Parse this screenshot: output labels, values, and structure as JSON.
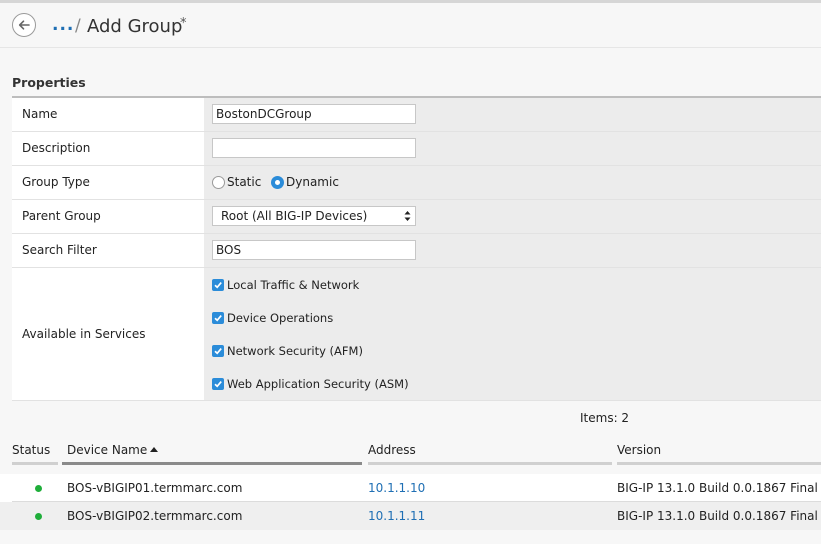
{
  "header": {
    "breadcrumb_ellipsis": "...",
    "separator": "/",
    "title": "Add Group",
    "unsaved_marker": "*"
  },
  "properties": {
    "section_title": "Properties",
    "fields": {
      "name": {
        "label": "Name",
        "value": "BostonDCGroup"
      },
      "description": {
        "label": "Description",
        "value": ""
      },
      "group_type": {
        "label": "Group Type",
        "options": [
          {
            "label": "Static",
            "selected": false
          },
          {
            "label": "Dynamic",
            "selected": true
          }
        ]
      },
      "parent_group": {
        "label": "Parent Group",
        "value": "Root (All BIG-IP Devices)"
      },
      "search_filter": {
        "label": "Search Filter",
        "value": "BOS"
      },
      "available_in_services": {
        "label": "Available in Services",
        "options": [
          {
            "label": "Local Traffic & Network",
            "checked": true
          },
          {
            "label": "Device Operations",
            "checked": true
          },
          {
            "label": "Network Security (AFM)",
            "checked": true
          },
          {
            "label": "Web Application Security (ASM)",
            "checked": true
          }
        ]
      }
    }
  },
  "devices": {
    "items_count": "Items: 2",
    "columns": {
      "status": "Status",
      "device_name": "Device Name",
      "address": "Address",
      "version": "Version"
    },
    "sorted_column": "device_name",
    "sort_direction": "ascending",
    "rows": [
      {
        "status": "online",
        "device_name": "BOS-vBIGIP01.termmarc.com",
        "address": "10.1.1.10",
        "version": "BIG-IP 13.1.0 Build 0.0.1867 Final"
      },
      {
        "status": "online",
        "device_name": "BOS-vBIGIP02.termmarc.com",
        "address": "10.1.1.11",
        "version": "BIG-IP 13.1.0 Build 0.0.1867 Final"
      }
    ]
  },
  "colors": {
    "accent": "#2b8cd9",
    "link": "#1f6fb4",
    "status_online": "#1fae3a"
  },
  "icons": {
    "back": "back-arrow-icon",
    "select": "select-arrows-icon",
    "checkbox": "checkmark-icon",
    "sort": "sort-ascending-icon",
    "status": "status-dot-icon"
  }
}
